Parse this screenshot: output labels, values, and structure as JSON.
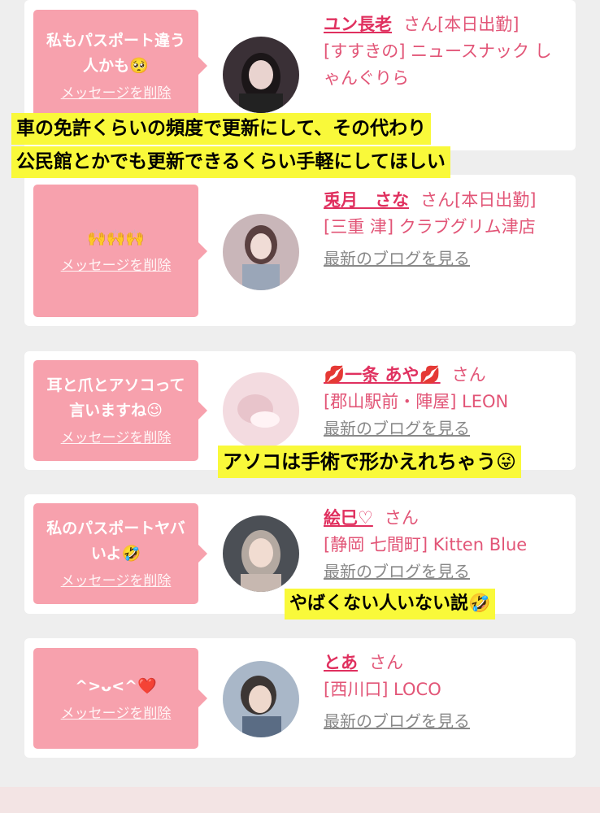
{
  "delete_label": "メッセージを削除",
  "cards": [
    {
      "message": "私もパスポート違う人かも🥺",
      "name": "ユン長老",
      "suffix": "さん",
      "status": "[本日出勤]",
      "area_shop": "[すすきの] ニュースナック しゃんぐりら",
      "blog": "最新のブログを見る"
    },
    {
      "message": "🙌🙌🙌",
      "name": "兎月　さな",
      "suffix": "さん",
      "status": "[本日出勤]",
      "area_shop": "[三重 津] クラブグリム津店",
      "blog": "最新のブログを見る"
    },
    {
      "message": "耳と爪とアソコって言いますね😉",
      "name": "💋一条 あや💋",
      "suffix": "さん",
      "status": "",
      "area_shop": "[郡山駅前・陣屋] LEON",
      "blog": "最新のブログを見る"
    },
    {
      "message": "私のパスポートヤバいよ🤣",
      "name": "絵巳♡",
      "suffix": "さん",
      "status": "",
      "area_shop": "[静岡 七間町] Kitten Blue",
      "blog": "最新のブログを見る"
    },
    {
      "message": "^>ᴗ<^❤️",
      "name": "とあ",
      "suffix": "さん",
      "status": "",
      "area_shop": "[西川口] LOCO",
      "blog": "最新のブログを見る"
    }
  ],
  "overlays": {
    "line1": "車の免許くらいの頻度で更新にして、その代わり",
    "line2": "公民館とかでも更新できるくらい手軽にしてほしい",
    "line3": "アソコは手術で形かえれちゃう😜",
    "line4": "やばくない人いない説🤣"
  },
  "colors": {
    "bubble": "#f7a1ad",
    "name": "#e0305f",
    "highlight": "#f9f93a"
  }
}
